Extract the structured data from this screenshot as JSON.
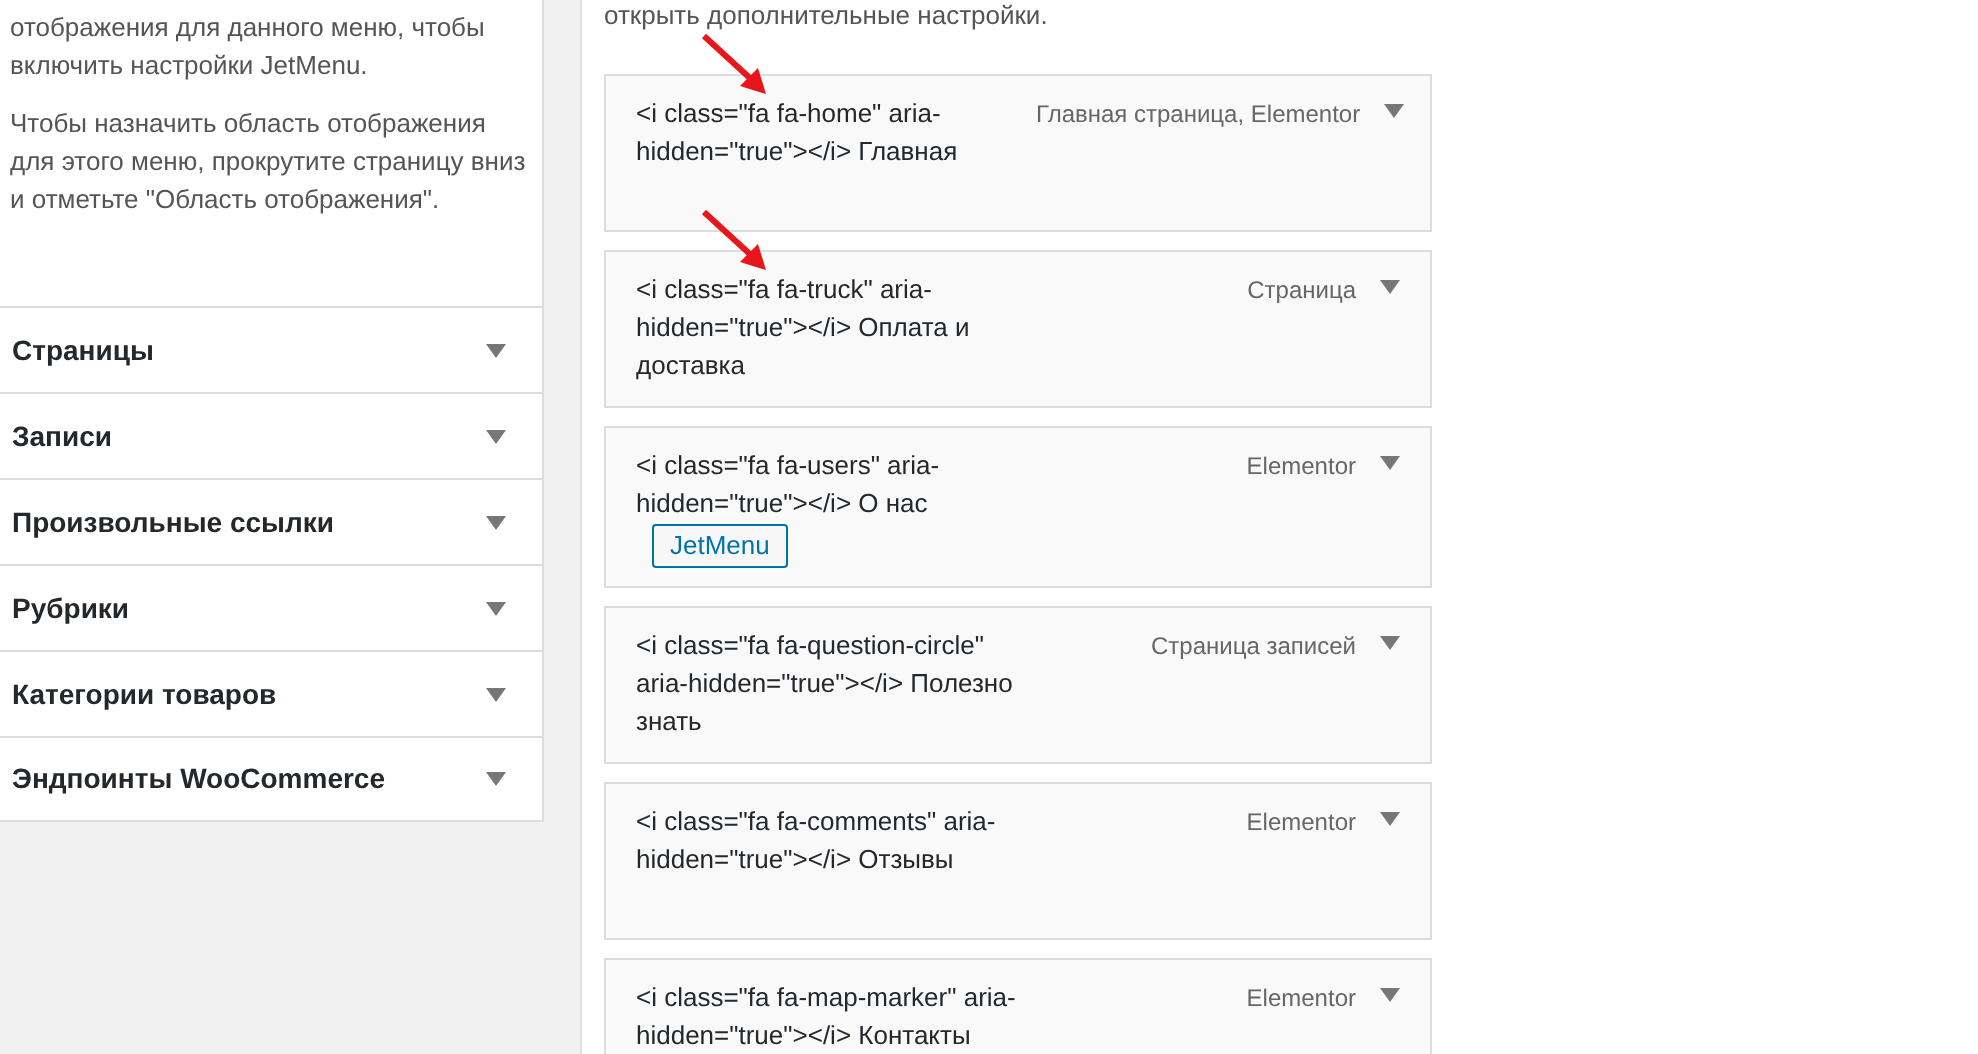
{
  "sidebar": {
    "notes": [
      "отображения для данного меню, чтобы включить настройки JetMenu.",
      "Чтобы назначить область отображения для этого меню, прокрутите страницу вниз и отметьте \"Область отображения\"."
    ],
    "sections": [
      {
        "label": "Страницы",
        "expanded": false
      },
      {
        "label": "Записи",
        "expanded": false
      },
      {
        "label": "Произвольные ссылки",
        "expanded": false
      },
      {
        "label": "Рубрики",
        "expanded": false
      },
      {
        "label": "Категории товаров",
        "expanded": false
      },
      {
        "label": "Эндпоинты WooCommerce",
        "expanded": false
      }
    ]
  },
  "menu": {
    "hint": "открыть дополнительные настройки.",
    "items": [
      {
        "title": "<i class=\"fa fa-home\" aria-hidden=\"true\"></i> Главная",
        "type": "Главная страница, Elementor",
        "arrow_marked": true
      },
      {
        "title": "<i class=\"fa fa-truck\" aria-hidden=\"true\"></i> Оплата и доставка",
        "type": "Страница",
        "arrow_marked": true
      },
      {
        "title": "<i class=\"fa fa-users\" aria-hidden=\"true\"></i> О нас",
        "type": "Elementor",
        "arrow_marked": false,
        "button": "JetMenu"
      },
      {
        "title": "<i class=\"fa fa-question-circle\" aria-hidden=\"true\"></i> Полезно знать",
        "type": "Страница записей",
        "arrow_marked": false
      },
      {
        "title": "<i class=\"fa fa-comments\" aria-hidden=\"true\"></i> Отзывы",
        "type": "Elementor",
        "arrow_marked": false
      },
      {
        "title": "<i class=\"fa fa-map-marker\" aria-hidden=\"true\"></i> Контакты",
        "type": "Elementor",
        "arrow_marked": false
      }
    ]
  }
}
